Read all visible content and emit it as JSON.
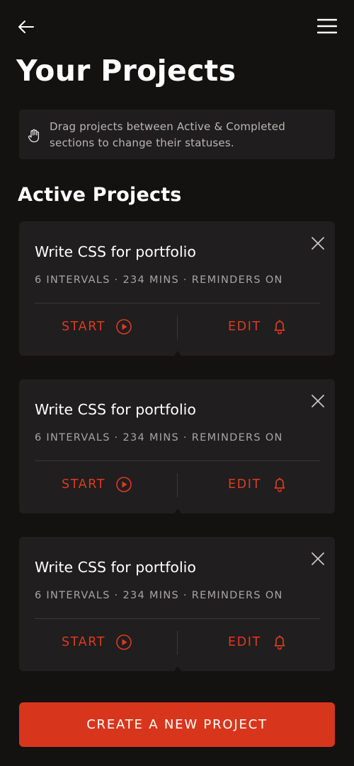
{
  "header": {
    "back_icon": "arrow-left-icon",
    "menu_icon": "hamburger-menu-icon"
  },
  "page": {
    "title": "Your Projects"
  },
  "hint": {
    "icon": "hand-grab-icon",
    "text": "Drag projects between Active & Completed sections to change their statuses."
  },
  "sections": {
    "active_title": "Active Projects"
  },
  "projects": [
    {
      "title": "Write CSS for portfolio",
      "meta": "6 INTERVALS · 234 MINS · REMINDERS ON",
      "start_label": "START",
      "edit_label": "EDIT"
    },
    {
      "title": "Write CSS for portfolio",
      "meta": "6 INTERVALS · 234 MINS · REMINDERS ON",
      "start_label": "START",
      "edit_label": "EDIT"
    },
    {
      "title": "Write CSS for portfolio",
      "meta": "6 INTERVALS · 234 MINS · REMINDERS ON",
      "start_label": "START",
      "edit_label": "EDIT"
    }
  ],
  "footer": {
    "create_label": "CREATE A NEW PROJECT"
  },
  "colors": {
    "background": "#141111",
    "card": "#201e1f",
    "accent": "#de3a22",
    "button": "#d8361c"
  }
}
